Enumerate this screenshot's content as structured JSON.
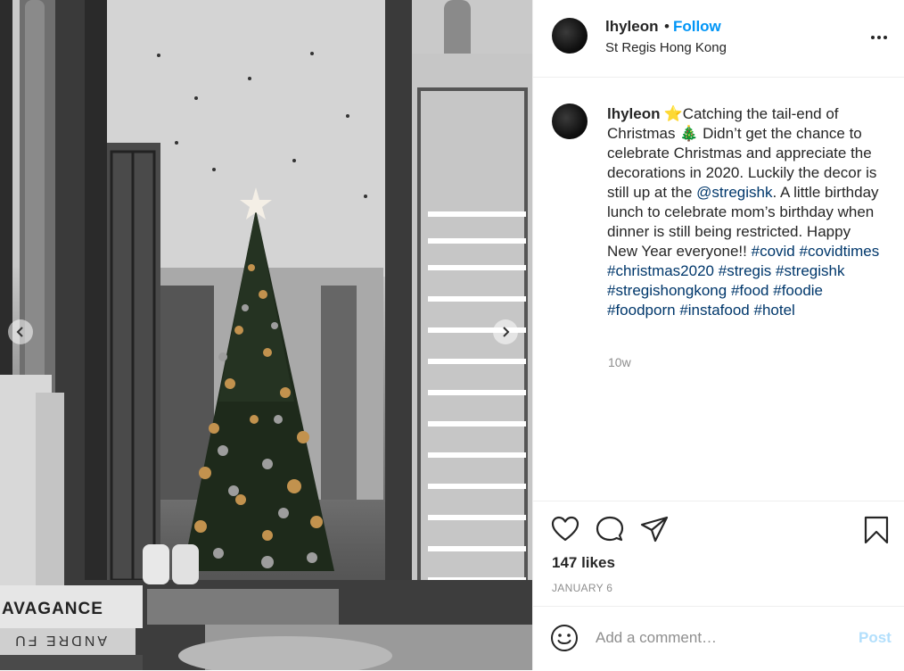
{
  "post": {
    "username": "lhyleon",
    "separator": "•",
    "follow_label": "Follow",
    "location": "St Regis Hong Kong",
    "caption": {
      "username": "lhyleon",
      "star": "⭐",
      "text1": "Catching the tail-end of Christmas ",
      "tree": "🎄",
      "text2": " Didn’t get the chance to celebrate Christmas and appreciate the decorations in 2020. Luckily the decor is still up at the ",
      "mention": "@stregishk",
      "text3": ". A little birthday lunch to celebrate mom’s birthday when dinner is still being restricted. Happy New Year everyone!! ",
      "hashtags": [
        "#covid",
        "#covidtimes",
        "#christmas2020",
        "#stregis",
        "#stregishk",
        "#stregishongkong",
        "#food",
        "#foodie",
        "#foodporn",
        "#instafood",
        "#hotel"
      ]
    },
    "time_ago": "10w",
    "likes": "147 likes",
    "date": "JANUARY 6"
  },
  "photo_text": {
    "book_top": "AVAGANCE",
    "book_bottom": "ANDRE FU"
  },
  "comment": {
    "placeholder": "Add a comment…",
    "post_label": "Post"
  },
  "colors": {
    "accent": "#0095f6",
    "link": "#00376b",
    "muted": "#8e8e8e",
    "post_disabled": "#b2dffc"
  },
  "icons": [
    "more-options-icon",
    "heart-icon",
    "comment-icon",
    "share-icon",
    "bookmark-icon",
    "emoji-icon",
    "chevron-left-icon",
    "chevron-right-icon"
  ]
}
